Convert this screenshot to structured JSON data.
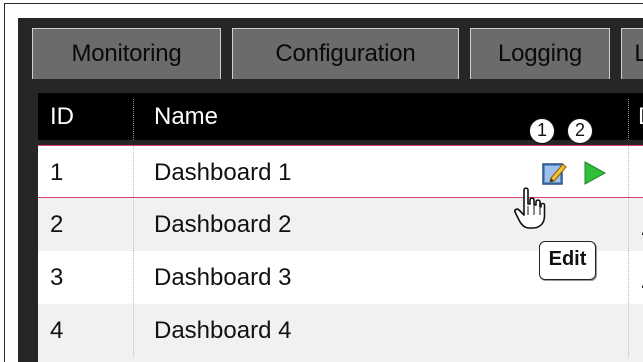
{
  "tabs": [
    {
      "label": "Monitoring"
    },
    {
      "label": "Configuration"
    },
    {
      "label": "Logging"
    },
    {
      "label": "L"
    }
  ],
  "table": {
    "headers": {
      "id": "ID",
      "name": "Name",
      "more": "D"
    },
    "rows": [
      {
        "id": "1",
        "name": "Dashboard 1",
        "trail": ""
      },
      {
        "id": "2",
        "name": "Dashboard 2",
        "trail": "."
      },
      {
        "id": "3",
        "name": "Dashboard 3",
        "trail": "."
      },
      {
        "id": "4",
        "name": "Dashboard 4",
        "trail": ""
      }
    ]
  },
  "row_actions": {
    "edit_icon": "pencil-edit-icon",
    "run_icon": "play-icon"
  },
  "callouts": {
    "first": "1",
    "second": "2"
  },
  "tooltip": {
    "text": "Edit"
  },
  "colors": {
    "header_bg": "#000000",
    "tab_bg": "#6b6b6b",
    "selected_border": "#d9466a",
    "play": "#2fbf3a"
  }
}
